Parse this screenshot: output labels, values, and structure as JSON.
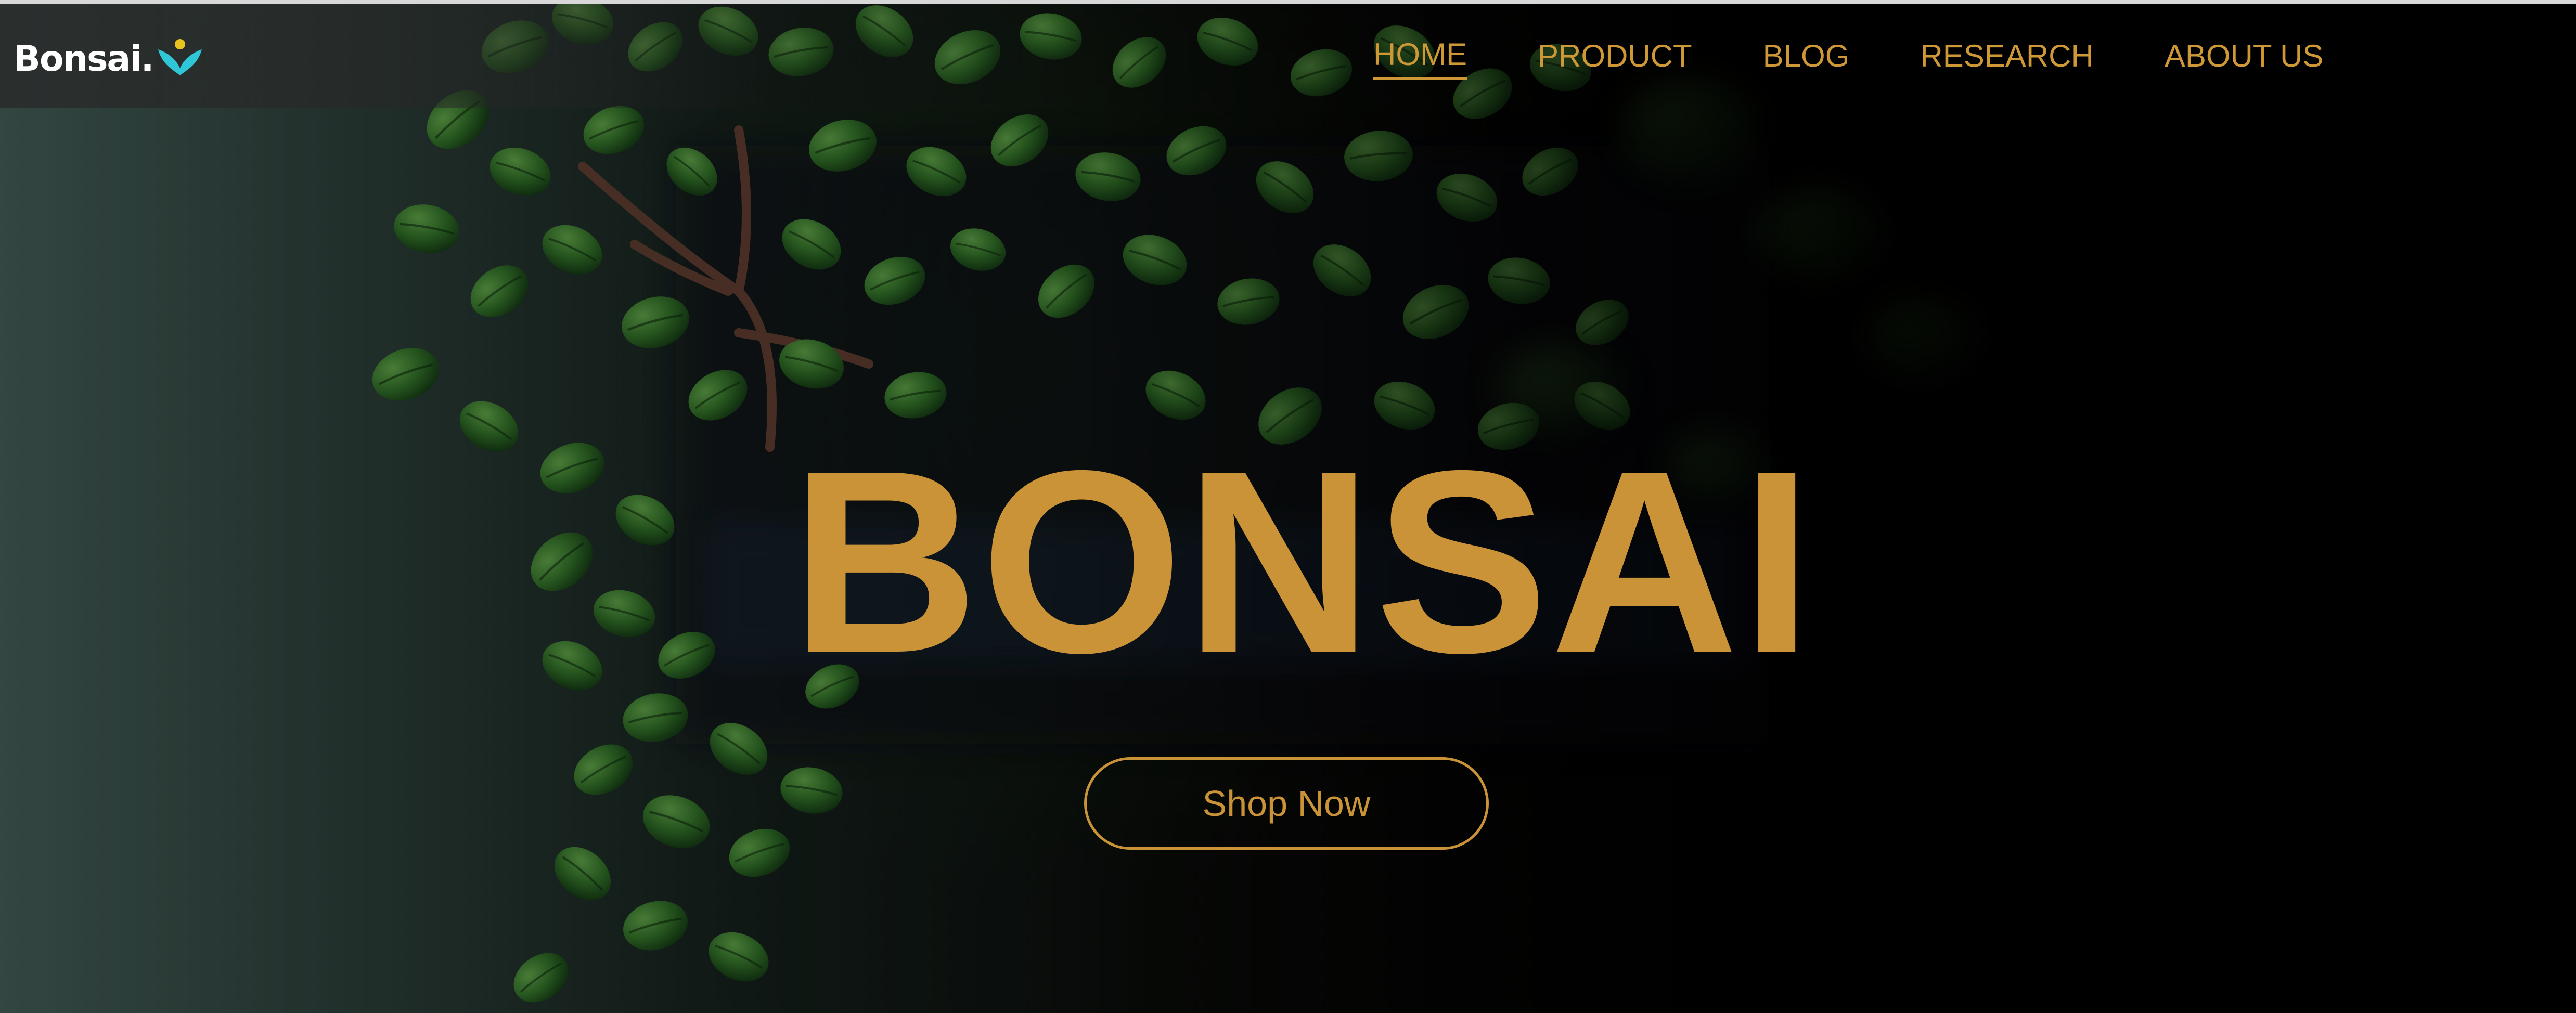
{
  "brand": {
    "name": "Bonsai.",
    "icon": "sprout-logo-icon",
    "colors": {
      "logo_text": "#ffffff",
      "logo_leaf": "#2fc6d8",
      "logo_dot": "#e8c51e"
    }
  },
  "nav": {
    "items": [
      {
        "label": "HOME",
        "active": true
      },
      {
        "label": "PRODUCT",
        "active": false
      },
      {
        "label": "BLOG",
        "active": false
      },
      {
        "label": "RESEARCH",
        "active": false
      },
      {
        "label": "ABOUT US",
        "active": false
      }
    ],
    "color": "#cf9837"
  },
  "hero": {
    "title": "BONSAI",
    "cta_label": "Shop Now",
    "accent_color": "#cb9337",
    "background": "bonsai-plant-photo"
  }
}
